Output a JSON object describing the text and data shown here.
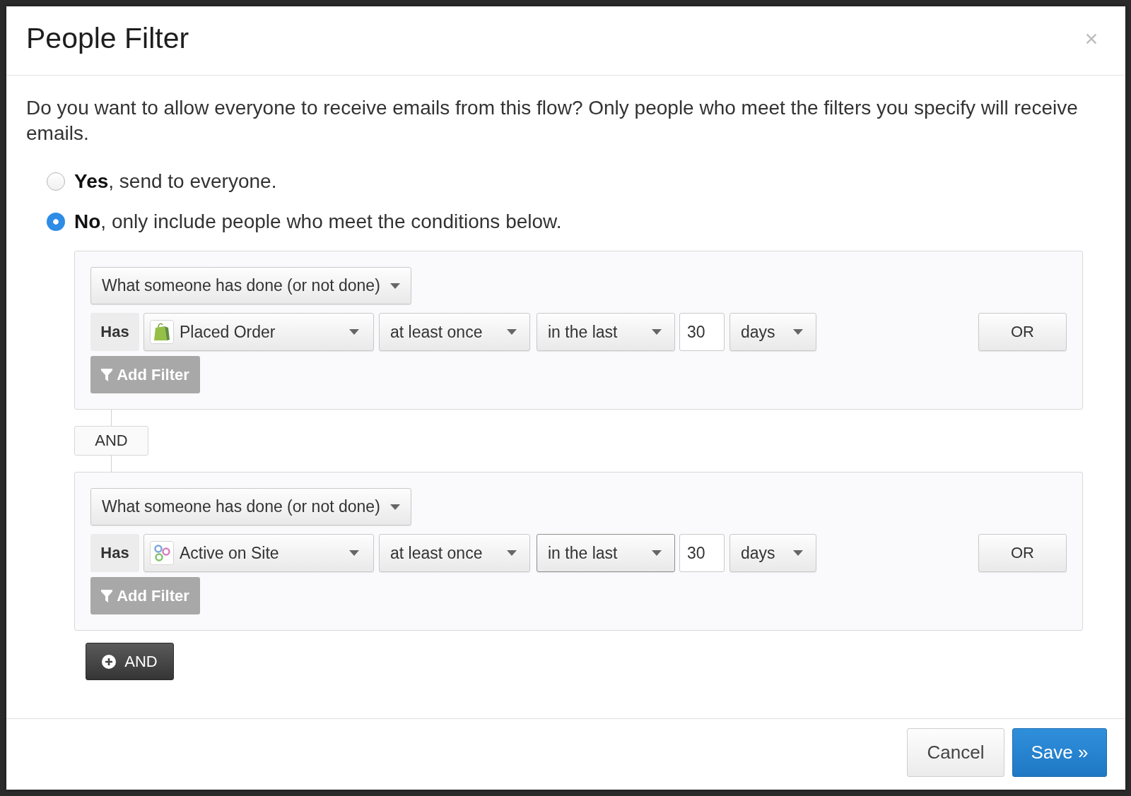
{
  "dialog": {
    "title": "People Filter"
  },
  "prompt": "Do you want to allow everyone to receive emails from this flow? Only people who meet the filters you specify will receive emails.",
  "options": [
    {
      "label": "**Yes**, send to everyone.",
      "selected": false
    },
    {
      "label": "**No**, only include people who meet the conditions below.",
      "selected": true
    }
  ],
  "groups": [
    {
      "condition_type": "What someone has done (or not done)",
      "has_label": "Has",
      "metric": {
        "label": "Placed Order",
        "kind": "store"
      },
      "frequency": "at least once",
      "timeframe": {
        "label": "in the last",
        "focused": false
      },
      "count": "30",
      "unit": "days",
      "or_button": "OR",
      "add_filter": "Add Filter"
    },
    {
      "joiner": "AND",
      "condition_type": "What someone has done (or not done)",
      "has_label": "Has",
      "metric": {
        "label": "Active on Site",
        "kind": "site"
      },
      "frequency": "at least once",
      "timeframe": {
        "label": "in the last",
        "focused": true
      },
      "count": "30",
      "unit": "days",
      "or_button": "OR",
      "add_filter": "Add Filter"
    }
  ],
  "add_and_button": "AND",
  "footer": {
    "buttons": [
      {
        "label": "Cancel",
        "kind": "secondary"
      },
      {
        "label": "Save »",
        "kind": "primary"
      }
    ]
  }
}
